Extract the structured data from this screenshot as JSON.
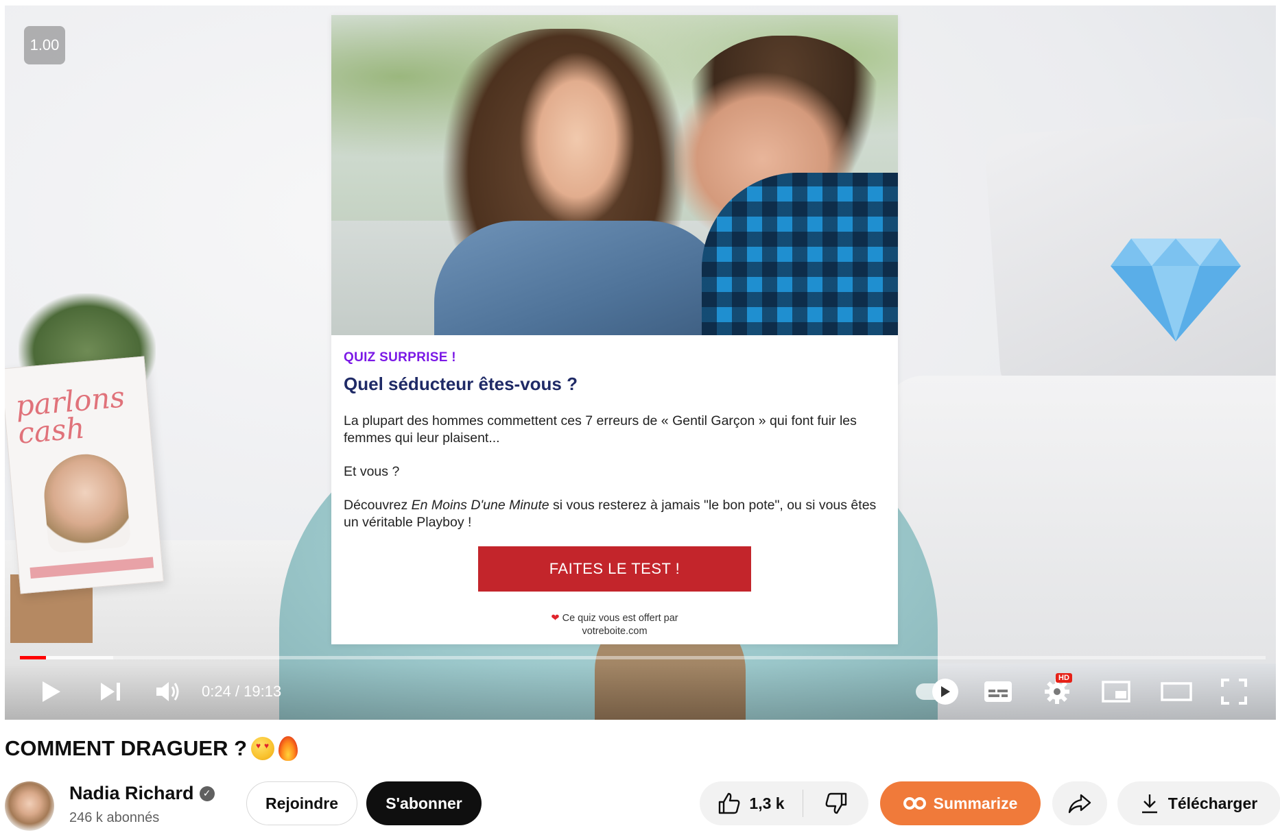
{
  "player": {
    "speed_badge": "1.00",
    "time": {
      "current": "0:24",
      "total": "19:13",
      "display": "0:24 / 19:13"
    },
    "progress": {
      "played_fraction": 0.021,
      "buffered_fraction": 0.075
    },
    "accent_color": "#ff0000",
    "controls": {
      "play_icon": "play-icon",
      "next_icon": "next-icon",
      "volume_icon": "volume-icon",
      "autoplay_icon": "autoplay-toggle-icon",
      "subtitles_icon": "subtitles-icon",
      "settings_icon": "gear-icon",
      "settings_badge": "HD",
      "miniplayer_icon": "miniplayer-icon",
      "theater_icon": "theater-icon",
      "fullscreen_icon": "fullscreen-icon"
    },
    "background_book_title": "parlons cash"
  },
  "quiz": {
    "kicker": "QUIZ SURPRISE !",
    "heading": "Quel séducteur êtes-vous ?",
    "paragraph1": "La plupart des hommes commettent ces 7 erreurs de « Gentil Garçon » qui font fuir les femmes qui leur plaisent...",
    "paragraph2": "Et vous ?",
    "paragraph3_before": "Découvrez ",
    "paragraph3_em": "En Moins D'une Minute",
    "paragraph3_after": " si vous resterez à jamais \"le bon pote\", ou si vous êtes un véritable Playboy !",
    "cta_label": "FAITES LE TEST !",
    "footer_line1": "Ce quiz vous est offert par",
    "footer_line2": "votreboite.com",
    "kicker_color": "#7b19e6",
    "heading_color": "#1f2a66",
    "cta_color": "#c3252b"
  },
  "video": {
    "title": "COMMENT DRAGUER ?",
    "title_emojis": [
      "heart-eyes-emoji",
      "fire-emoji"
    ]
  },
  "channel": {
    "name": "Nadia Richard",
    "subscribers": "246 k abonnés"
  },
  "actions": {
    "join_label": "Rejoindre",
    "subscribe_label": "S'abonner",
    "like_count": "1,3 k",
    "summarize_label": "Summarize",
    "download_label": "Télécharger",
    "summarize_color": "#f07a3a"
  }
}
